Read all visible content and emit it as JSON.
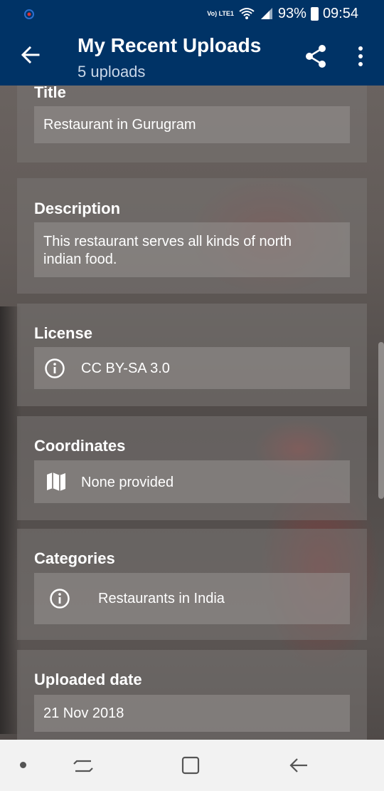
{
  "status_bar": {
    "network": "Vo) LTE1",
    "battery": "93%",
    "time": "09:54"
  },
  "toolbar": {
    "title": "My Recent Uploads",
    "subtitle": "5 uploads"
  },
  "details": {
    "title": {
      "label": "Title",
      "value": "Restaurant in Gurugram"
    },
    "description": {
      "label": "Description",
      "value_line1": "This restaurant serves all kinds of north",
      "value_line2": "indian food."
    },
    "license": {
      "label": "License",
      "value": "CC BY-SA 3.0",
      "icon": "info-icon"
    },
    "coordinates": {
      "label": "Coordinates",
      "value": "None provided",
      "icon": "map-icon"
    },
    "categories": {
      "label": "Categories",
      "items": [
        "Restaurants in India"
      ],
      "icon": "info-icon"
    },
    "uploaded_date": {
      "label": "Uploaded date",
      "value": "21 Nov 2018"
    }
  },
  "colors": {
    "app_bar": "#003366",
    "nav_bar": "#f2f2f2"
  }
}
